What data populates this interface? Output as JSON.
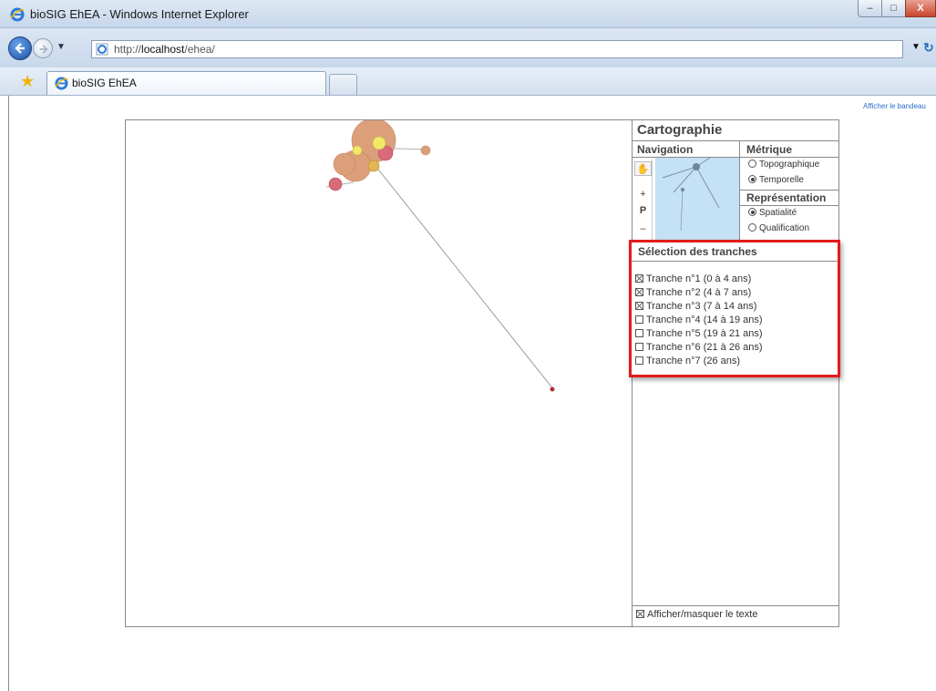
{
  "window": {
    "title": "bioSIG EhEA - Windows Internet Explorer",
    "controls": {
      "minimize": "–",
      "maximize": "□",
      "close": "X"
    }
  },
  "address": {
    "url_prefix": "http://",
    "url_host": "localhost",
    "url_path": "/ehea/"
  },
  "tabs": [
    {
      "label": "bioSIG EhEA",
      "active": true
    }
  ],
  "page": {
    "afficher_bandeau": "Afficher le bandeau",
    "panel": {
      "title": "Cartographie",
      "navigation_head": "Navigation",
      "metrique_head": "Métrique",
      "metrique_options": [
        {
          "label": "Topographique",
          "selected": false
        },
        {
          "label": "Temporelle",
          "selected": true
        }
      ],
      "representation_head": "Représentation",
      "representation_options": [
        {
          "label": "Spatialité",
          "selected": true
        },
        {
          "label": "Qualification",
          "selected": false
        }
      ],
      "tools": {
        "plus": "+",
        "p": "P",
        "minus": "–"
      },
      "selection": {
        "title": "Sélection des tranches",
        "tranches": [
          {
            "label": "Tranche n°1 (0 à 4 ans)",
            "checked": true
          },
          {
            "label": "Tranche n°2 (4 à 7 ans)",
            "checked": true
          },
          {
            "label": "Tranche n°3 (7 à 14 ans)",
            "checked": true
          },
          {
            "label": "Tranche n°4 (14 à 19 ans)",
            "checked": false
          },
          {
            "label": "Tranche n°5 (19 à 21 ans)",
            "checked": false
          },
          {
            "label": "Tranche n°6 (21 à 26 ans)",
            "checked": false
          },
          {
            "label": "Tranche n°7 (26 ans)",
            "checked": false
          }
        ]
      },
      "footer_toggle": {
        "label": "Afficher/masquer le texte",
        "checked": true
      }
    }
  },
  "colors": {
    "highlight_border": "#e31b1b",
    "circle_orange": "#dba07a",
    "circle_pink": "#d86a7a",
    "circle_yellow": "#f3e866",
    "circle_gold": "#e5b454",
    "minimap_bg": "#c4e1f6",
    "link_blue": "#2a6fc9"
  }
}
